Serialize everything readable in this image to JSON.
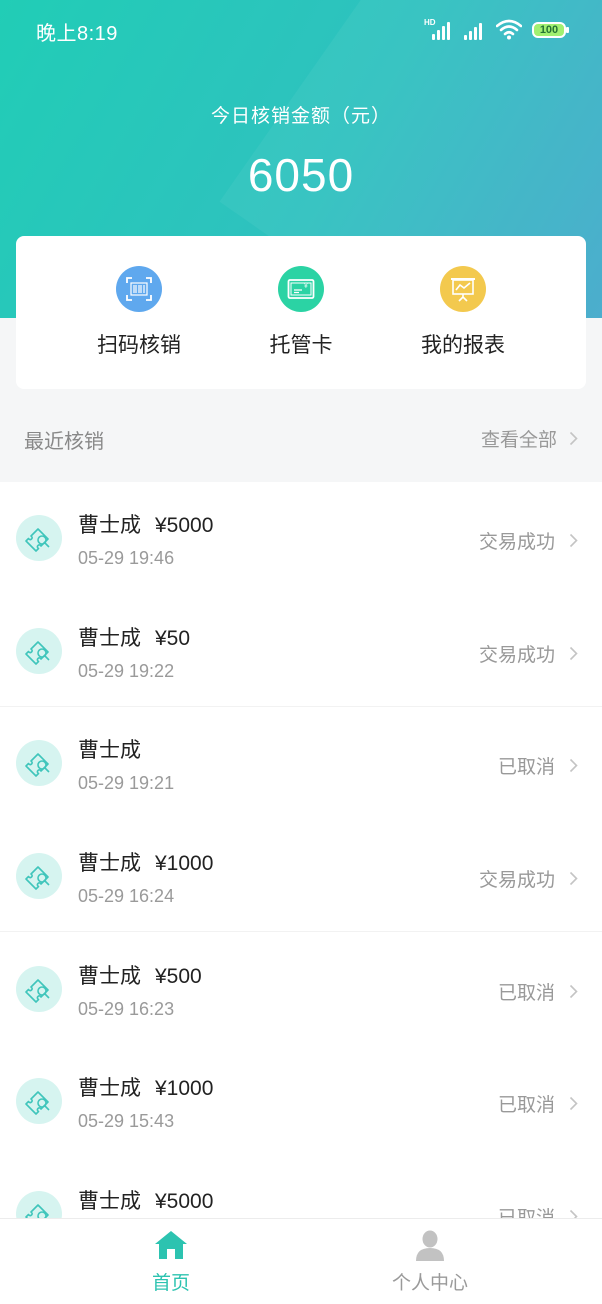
{
  "status_bar": {
    "time": "晚上8:19",
    "battery": "100"
  },
  "header": {
    "label": "今日核销金额（元）",
    "amount": "6050",
    "colors": {
      "gradient_start": "#21cdb6",
      "gradient_end": "#43a9cb"
    }
  },
  "quick_actions": [
    {
      "label": "扫码核销",
      "icon": "barcode-scan-icon",
      "color": "#5fa8ee"
    },
    {
      "label": "托管卡",
      "icon": "card-icon",
      "color": "#2bd3a4"
    },
    {
      "label": "我的报表",
      "icon": "report-icon",
      "color": "#f3c94e"
    }
  ],
  "recent": {
    "title": "最近核销",
    "view_all": "查看全部"
  },
  "records": [
    {
      "name": "曹士成",
      "amount": "¥5000",
      "time": "05-29 19:46",
      "status": "交易成功"
    },
    {
      "name": "曹士成",
      "amount": "¥50",
      "time": "05-29 19:22",
      "status": "交易成功"
    },
    {
      "name": "曹士成",
      "amount": "",
      "time": "05-29 19:21",
      "status": "已取消"
    },
    {
      "name": "曹士成",
      "amount": "¥1000",
      "time": "05-29 16:24",
      "status": "交易成功"
    },
    {
      "name": "曹士成",
      "amount": "¥500",
      "time": "05-29 16:23",
      "status": "已取消"
    },
    {
      "name": "曹士成",
      "amount": "¥1000",
      "time": "05-29 15:43",
      "status": "已取消"
    },
    {
      "name": "曹士成",
      "amount": "¥5000",
      "time": "",
      "status": "已取消"
    }
  ],
  "tabbar": {
    "home": "首页",
    "profile": "个人中心",
    "active_color": "#2cc3b0",
    "inactive_color": "#9a9a9a"
  }
}
